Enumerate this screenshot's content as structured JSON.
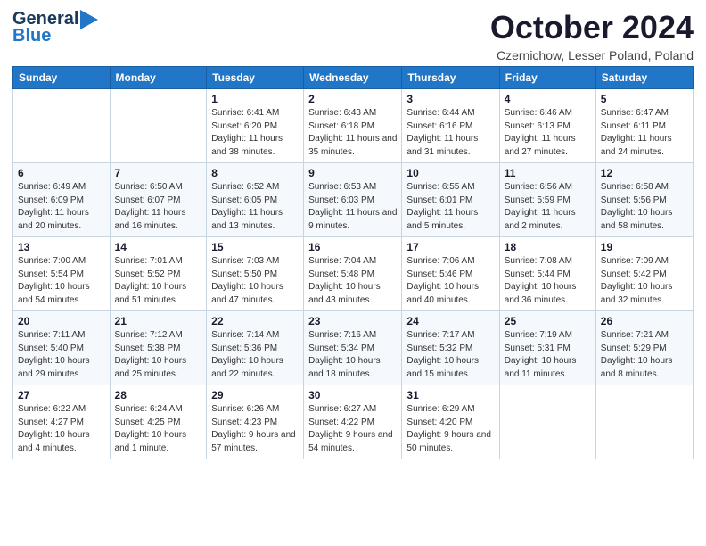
{
  "header": {
    "logo_line1": "General",
    "logo_line2": "Blue",
    "month": "October 2024",
    "location": "Czernichow, Lesser Poland, Poland"
  },
  "weekdays": [
    "Sunday",
    "Monday",
    "Tuesday",
    "Wednesday",
    "Thursday",
    "Friday",
    "Saturday"
  ],
  "weeks": [
    [
      {
        "day": "",
        "sunrise": "",
        "sunset": "",
        "daylight": ""
      },
      {
        "day": "",
        "sunrise": "",
        "sunset": "",
        "daylight": ""
      },
      {
        "day": "1",
        "sunrise": "Sunrise: 6:41 AM",
        "sunset": "Sunset: 6:20 PM",
        "daylight": "Daylight: 11 hours and 38 minutes."
      },
      {
        "day": "2",
        "sunrise": "Sunrise: 6:43 AM",
        "sunset": "Sunset: 6:18 PM",
        "daylight": "Daylight: 11 hours and 35 minutes."
      },
      {
        "day": "3",
        "sunrise": "Sunrise: 6:44 AM",
        "sunset": "Sunset: 6:16 PM",
        "daylight": "Daylight: 11 hours and 31 minutes."
      },
      {
        "day": "4",
        "sunrise": "Sunrise: 6:46 AM",
        "sunset": "Sunset: 6:13 PM",
        "daylight": "Daylight: 11 hours and 27 minutes."
      },
      {
        "day": "5",
        "sunrise": "Sunrise: 6:47 AM",
        "sunset": "Sunset: 6:11 PM",
        "daylight": "Daylight: 11 hours and 24 minutes."
      }
    ],
    [
      {
        "day": "6",
        "sunrise": "Sunrise: 6:49 AM",
        "sunset": "Sunset: 6:09 PM",
        "daylight": "Daylight: 11 hours and 20 minutes."
      },
      {
        "day": "7",
        "sunrise": "Sunrise: 6:50 AM",
        "sunset": "Sunset: 6:07 PM",
        "daylight": "Daylight: 11 hours and 16 minutes."
      },
      {
        "day": "8",
        "sunrise": "Sunrise: 6:52 AM",
        "sunset": "Sunset: 6:05 PM",
        "daylight": "Daylight: 11 hours and 13 minutes."
      },
      {
        "day": "9",
        "sunrise": "Sunrise: 6:53 AM",
        "sunset": "Sunset: 6:03 PM",
        "daylight": "Daylight: 11 hours and 9 minutes."
      },
      {
        "day": "10",
        "sunrise": "Sunrise: 6:55 AM",
        "sunset": "Sunset: 6:01 PM",
        "daylight": "Daylight: 11 hours and 5 minutes."
      },
      {
        "day": "11",
        "sunrise": "Sunrise: 6:56 AM",
        "sunset": "Sunset: 5:59 PM",
        "daylight": "Daylight: 11 hours and 2 minutes."
      },
      {
        "day": "12",
        "sunrise": "Sunrise: 6:58 AM",
        "sunset": "Sunset: 5:56 PM",
        "daylight": "Daylight: 10 hours and 58 minutes."
      }
    ],
    [
      {
        "day": "13",
        "sunrise": "Sunrise: 7:00 AM",
        "sunset": "Sunset: 5:54 PM",
        "daylight": "Daylight: 10 hours and 54 minutes."
      },
      {
        "day": "14",
        "sunrise": "Sunrise: 7:01 AM",
        "sunset": "Sunset: 5:52 PM",
        "daylight": "Daylight: 10 hours and 51 minutes."
      },
      {
        "day": "15",
        "sunrise": "Sunrise: 7:03 AM",
        "sunset": "Sunset: 5:50 PM",
        "daylight": "Daylight: 10 hours and 47 minutes."
      },
      {
        "day": "16",
        "sunrise": "Sunrise: 7:04 AM",
        "sunset": "Sunset: 5:48 PM",
        "daylight": "Daylight: 10 hours and 43 minutes."
      },
      {
        "day": "17",
        "sunrise": "Sunrise: 7:06 AM",
        "sunset": "Sunset: 5:46 PM",
        "daylight": "Daylight: 10 hours and 40 minutes."
      },
      {
        "day": "18",
        "sunrise": "Sunrise: 7:08 AM",
        "sunset": "Sunset: 5:44 PM",
        "daylight": "Daylight: 10 hours and 36 minutes."
      },
      {
        "day": "19",
        "sunrise": "Sunrise: 7:09 AM",
        "sunset": "Sunset: 5:42 PM",
        "daylight": "Daylight: 10 hours and 32 minutes."
      }
    ],
    [
      {
        "day": "20",
        "sunrise": "Sunrise: 7:11 AM",
        "sunset": "Sunset: 5:40 PM",
        "daylight": "Daylight: 10 hours and 29 minutes."
      },
      {
        "day": "21",
        "sunrise": "Sunrise: 7:12 AM",
        "sunset": "Sunset: 5:38 PM",
        "daylight": "Daylight: 10 hours and 25 minutes."
      },
      {
        "day": "22",
        "sunrise": "Sunrise: 7:14 AM",
        "sunset": "Sunset: 5:36 PM",
        "daylight": "Daylight: 10 hours and 22 minutes."
      },
      {
        "day": "23",
        "sunrise": "Sunrise: 7:16 AM",
        "sunset": "Sunset: 5:34 PM",
        "daylight": "Daylight: 10 hours and 18 minutes."
      },
      {
        "day": "24",
        "sunrise": "Sunrise: 7:17 AM",
        "sunset": "Sunset: 5:32 PM",
        "daylight": "Daylight: 10 hours and 15 minutes."
      },
      {
        "day": "25",
        "sunrise": "Sunrise: 7:19 AM",
        "sunset": "Sunset: 5:31 PM",
        "daylight": "Daylight: 10 hours and 11 minutes."
      },
      {
        "day": "26",
        "sunrise": "Sunrise: 7:21 AM",
        "sunset": "Sunset: 5:29 PM",
        "daylight": "Daylight: 10 hours and 8 minutes."
      }
    ],
    [
      {
        "day": "27",
        "sunrise": "Sunrise: 6:22 AM",
        "sunset": "Sunset: 4:27 PM",
        "daylight": "Daylight: 10 hours and 4 minutes."
      },
      {
        "day": "28",
        "sunrise": "Sunrise: 6:24 AM",
        "sunset": "Sunset: 4:25 PM",
        "daylight": "Daylight: 10 hours and 1 minute."
      },
      {
        "day": "29",
        "sunrise": "Sunrise: 6:26 AM",
        "sunset": "Sunset: 4:23 PM",
        "daylight": "Daylight: 9 hours and 57 minutes."
      },
      {
        "day": "30",
        "sunrise": "Sunrise: 6:27 AM",
        "sunset": "Sunset: 4:22 PM",
        "daylight": "Daylight: 9 hours and 54 minutes."
      },
      {
        "day": "31",
        "sunrise": "Sunrise: 6:29 AM",
        "sunset": "Sunset: 4:20 PM",
        "daylight": "Daylight: 9 hours and 50 minutes."
      },
      {
        "day": "",
        "sunrise": "",
        "sunset": "",
        "daylight": ""
      },
      {
        "day": "",
        "sunrise": "",
        "sunset": "",
        "daylight": ""
      }
    ]
  ]
}
